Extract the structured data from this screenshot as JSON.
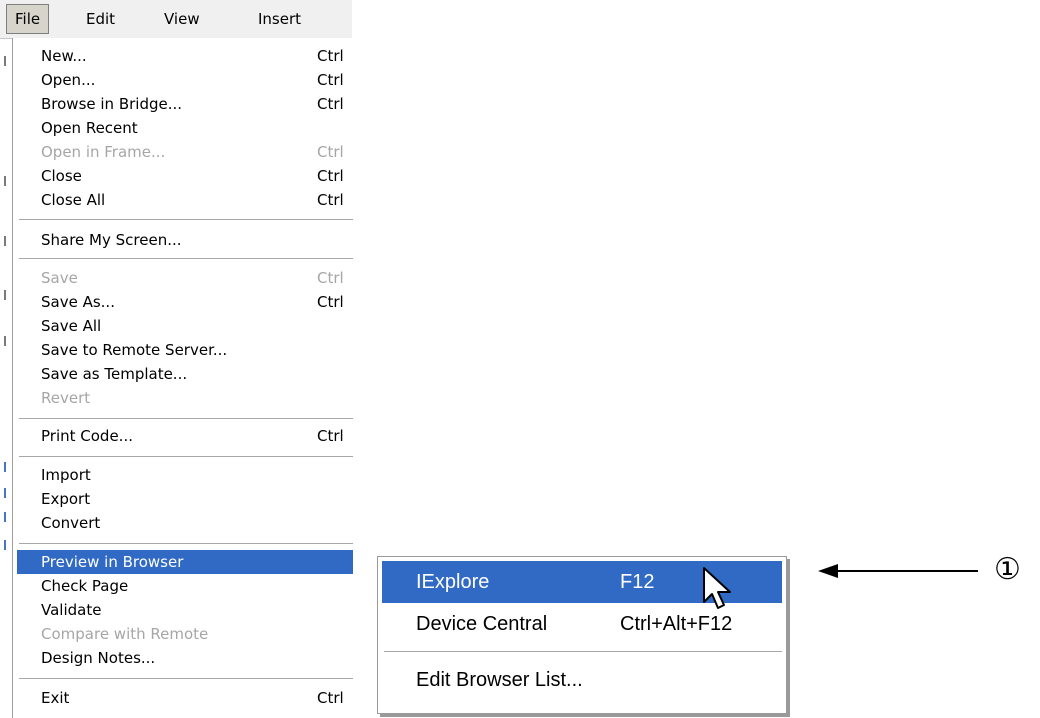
{
  "menubar": {
    "items": [
      {
        "label": "File",
        "active": true
      },
      {
        "label": "Edit"
      },
      {
        "label": "View"
      },
      {
        "label": "Insert"
      }
    ]
  },
  "file_menu": {
    "items": [
      {
        "label": "New...",
        "shortcut": "Ctrl"
      },
      {
        "label": "Open...",
        "shortcut": "Ctrl"
      },
      {
        "label": "Browse in Bridge...",
        "shortcut": "Ctrl"
      },
      {
        "label": "Open Recent",
        "shortcut": ""
      },
      {
        "label": "Open in Frame...",
        "shortcut": "Ctrl",
        "disabled": true
      },
      {
        "label": "Close",
        "shortcut": "Ctrl"
      },
      {
        "label": "Close All",
        "shortcut": "Ctrl"
      },
      {
        "label": "Share My Screen...",
        "shortcut": ""
      },
      {
        "label": "Save",
        "shortcut": "Ctrl",
        "disabled": true
      },
      {
        "label": "Save As...",
        "shortcut": "Ctrl"
      },
      {
        "label": "Save All",
        "shortcut": ""
      },
      {
        "label": "Save to Remote Server...",
        "shortcut": ""
      },
      {
        "label": "Save as Template...",
        "shortcut": ""
      },
      {
        "label": "Revert",
        "shortcut": "",
        "disabled": true
      },
      {
        "label": "Print Code...",
        "shortcut": "Ctrl"
      },
      {
        "label": "Import",
        "shortcut": ""
      },
      {
        "label": "Export",
        "shortcut": ""
      },
      {
        "label": "Convert",
        "shortcut": ""
      },
      {
        "label": "Preview in Browser",
        "shortcut": "",
        "highlighted": true
      },
      {
        "label": "Check Page",
        "shortcut": ""
      },
      {
        "label": "Validate",
        "shortcut": ""
      },
      {
        "label": "Compare with Remote",
        "shortcut": "",
        "disabled": true
      },
      {
        "label": "Design Notes...",
        "shortcut": ""
      },
      {
        "label": "Exit",
        "shortcut": "Ctrl"
      }
    ]
  },
  "browser_submenu": {
    "items": [
      {
        "label": "IExplore",
        "shortcut": "F12",
        "highlighted": true
      },
      {
        "label": "Device Central",
        "shortcut": "Ctrl+Alt+F12"
      },
      {
        "label": "Edit Browser List...",
        "shortcut": ""
      }
    ]
  },
  "callout": {
    "marker": "①"
  },
  "colors": {
    "highlight": "#316ac5",
    "disabled_text": "#a6a6a6"
  }
}
